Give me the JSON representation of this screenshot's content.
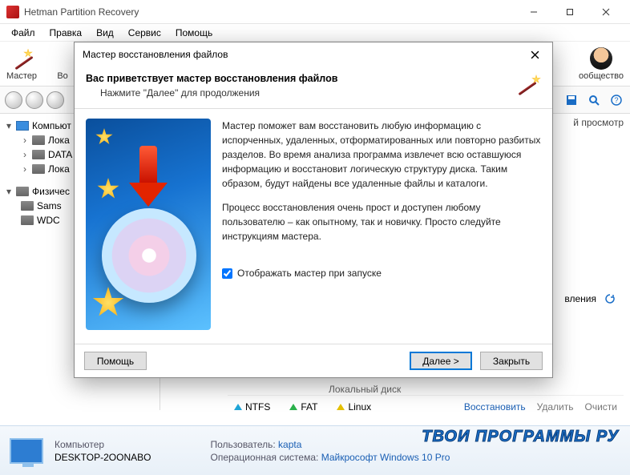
{
  "window": {
    "title": "Hetman Partition Recovery",
    "menus": [
      "Файл",
      "Правка",
      "Вид",
      "Сервис",
      "Помощь"
    ]
  },
  "toolbar": {
    "items": [
      {
        "label": "Мастер"
      },
      {
        "label": "Во"
      }
    ],
    "community_label": "ообщество"
  },
  "tree": {
    "root": "Компьют",
    "volumes": [
      "Лока",
      "DATA",
      "Лока"
    ],
    "phys_label": "Физичес",
    "disks": [
      "Sams",
      "WDC"
    ]
  },
  "preview_header": "й просмотр",
  "refresh_label": "вления",
  "above_fs": "Локальный диск",
  "fs": {
    "a": "NTFS",
    "b": "FAT",
    "c": "Linux",
    "act1": "Восстановить",
    "act2": "Удалить",
    "act3": "Очисти"
  },
  "footer": {
    "computer_label": "Компьютер",
    "computer_name": "DESKTOP-2OONABO",
    "user_label": "Пользователь:",
    "user_value": "kapta",
    "os_label": "Операционная система:",
    "os_value": "Майкрософт Windows 10 Pro"
  },
  "watermark": "ТВОИ ПРОГРАММЫ РУ",
  "wizard": {
    "title": "Мастер восстановления файлов",
    "heading": "Вас приветствует мастер восстановления файлов",
    "subheading": "Нажмите \"Далее\" для продолжения",
    "para1": "Мастер поможет вам восстановить любую информацию с испорченных, удаленных, отформатированных или повторно разбитых разделов. Во время анализа программа извлечет всю оставшуюся информацию и восстановит логическую структуру диска. Таким образом, будут найдены все удаленные файлы и каталоги.",
    "para2": "Процесс восстановления очень прост и доступен любому пользователю – как опытному, так и новичку. Просто следуйте инструкциям мастера.",
    "checkbox_label": "Отображать мастер при запуске",
    "checkbox_checked": true,
    "btn_help": "Помощь",
    "btn_next": "Далее >",
    "btn_close": "Закрыть"
  }
}
